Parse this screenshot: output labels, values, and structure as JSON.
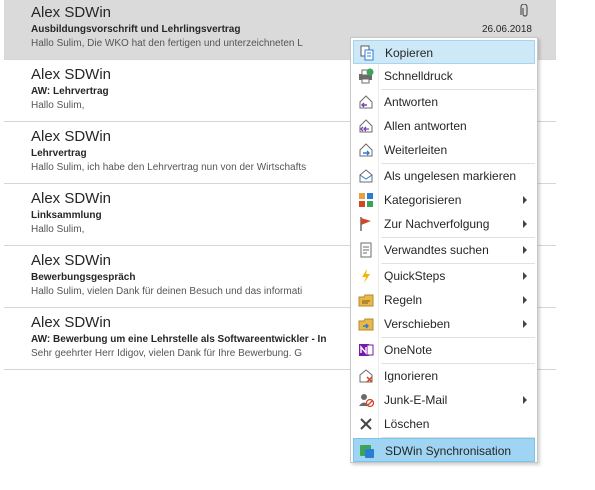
{
  "mails": [
    {
      "sender": "Alex SDWin",
      "subject": "Ausbildungsvorschrift und Lehrlingsvertrag",
      "preview": "Hallo Sulim,  Die WKO hat den fertigen und unterzeichneten L",
      "date": "26.06.2018",
      "attachment": true,
      "selected": true
    },
    {
      "sender": "Alex SDWin",
      "subject": "AW: Lehrvertrag",
      "preview": "Hallo Sulim,",
      "date": "",
      "attachment": false,
      "selected": false
    },
    {
      "sender": "Alex SDWin",
      "subject": "Lehrvertrag",
      "preview": "Hallo Sulim,  ich habe den Lehrvertrag nun von der Wirtschafts",
      "date": "",
      "attachment": false,
      "selected": false
    },
    {
      "sender": "Alex SDWin",
      "subject": "Linksammlung",
      "preview": "Hallo Sulim,",
      "date": "",
      "attachment": false,
      "selected": false
    },
    {
      "sender": "Alex SDWin",
      "subject": "Bewerbungsgespräch",
      "preview": "Hallo Sulim,  vielen Dank für deinen Besuch und das informati",
      "date": "",
      "attachment": false,
      "selected": false
    },
    {
      "sender": "Alex SDWin",
      "subject": "AW: Bewerbung um eine Lehrstelle als Softwareentwickler - In",
      "preview": "Sehr geehrter Herr Idigov,  vielen Dank für Ihre Bewerbung.  G",
      "date": "",
      "attachment": false,
      "selected": false
    }
  ],
  "context_menu": {
    "items": [
      {
        "label": "Kopieren",
        "icon": "copy-icon",
        "submenu": false
      },
      {
        "label": "Schnelldruck",
        "icon": "quick-print-icon",
        "submenu": false
      },
      {
        "label": "Antworten",
        "icon": "reply-icon",
        "submenu": false
      },
      {
        "label": "Allen antworten",
        "icon": "reply-all-icon",
        "submenu": false
      },
      {
        "label": "Weiterleiten",
        "icon": "forward-icon",
        "submenu": false
      },
      {
        "label": "Als ungelesen markieren",
        "icon": "mark-unread-icon",
        "submenu": false
      },
      {
        "label": "Kategorisieren",
        "icon": "categorize-icon",
        "submenu": true
      },
      {
        "label": "Zur Nachverfolgung",
        "icon": "follow-up-flag-icon",
        "submenu": true
      },
      {
        "label": "Verwandtes suchen",
        "icon": "find-related-icon",
        "submenu": true
      },
      {
        "label": "QuickSteps",
        "icon": "quicksteps-icon",
        "submenu": true
      },
      {
        "label": "Regeln",
        "icon": "rules-icon",
        "submenu": true
      },
      {
        "label": "Verschieben",
        "icon": "move-icon",
        "submenu": true
      },
      {
        "label": "OneNote",
        "icon": "onenote-icon",
        "submenu": false
      },
      {
        "label": "Ignorieren",
        "icon": "ignore-icon",
        "submenu": false
      },
      {
        "label": "Junk-E-Mail",
        "icon": "junk-mail-icon",
        "submenu": true
      },
      {
        "label": "Löschen",
        "icon": "delete-icon",
        "submenu": false
      },
      {
        "label": "SDWin Synchronisation",
        "icon": "sdwin-sync-icon",
        "submenu": false
      }
    ]
  },
  "colors": {
    "menu_hover": "#cde8f7",
    "menu_selected": "#9fd4f2",
    "selected_mail": "#dadada",
    "accent_blue": "#2b7cd3"
  }
}
